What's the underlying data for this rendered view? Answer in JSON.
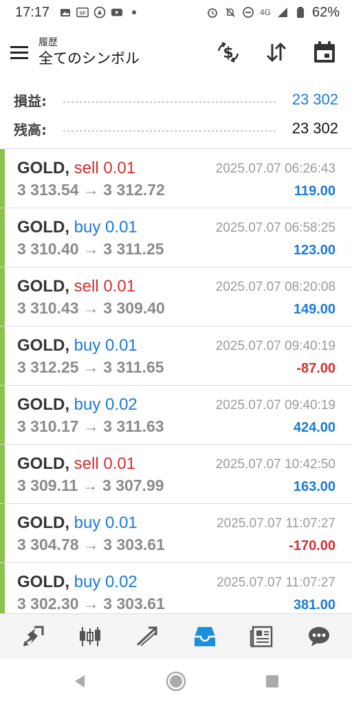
{
  "status_bar": {
    "time": "17:17",
    "network": "4G",
    "battery": "62%",
    "left_icons": [
      "photo-icon",
      "sf-icon",
      "notification-icon",
      "youtube-icon",
      "dot-icon"
    ],
    "right_icons": [
      "alarm-icon",
      "mute-icon",
      "dnd-icon",
      "signal-icon",
      "battery-icon"
    ]
  },
  "app_bar": {
    "subtitle": "履歴",
    "title": "全てのシンボル",
    "actions": [
      "deposit-icon",
      "sort-icon",
      "calendar-icon"
    ]
  },
  "summary": {
    "profit_label": "損益:",
    "profit_value": "23 302",
    "balance_label": "残高:",
    "balance_value": "23 302"
  },
  "trades": [
    {
      "symbol": "GOLD,",
      "side": "sell",
      "volume": "0.01",
      "prices": "3 313.54 → 3 312.72",
      "time": "2025.07.07 06:26:43",
      "profit": "119.00"
    },
    {
      "symbol": "GOLD,",
      "side": "buy",
      "volume": "0.01",
      "prices": "3 310.40 → 3 311.25",
      "time": "2025.07.07 06:58:25",
      "profit": "123.00"
    },
    {
      "symbol": "GOLD,",
      "side": "sell",
      "volume": "0.01",
      "prices": "3 310.43 → 3 309.40",
      "time": "2025.07.07 08:20:08",
      "profit": "149.00"
    },
    {
      "symbol": "GOLD,",
      "side": "buy",
      "volume": "0.01",
      "prices": "3 312.25 → 3 311.65",
      "time": "2025.07.07 09:40:19",
      "profit": "-87.00"
    },
    {
      "symbol": "GOLD,",
      "side": "buy",
      "volume": "0.02",
      "prices": "3 310.17 → 3 311.63",
      "time": "2025.07.07 09:40:19",
      "profit": "424.00"
    },
    {
      "symbol": "GOLD,",
      "side": "sell",
      "volume": "0.01",
      "prices": "3 309.11 → 3 307.99",
      "time": "2025.07.07 10:42:50",
      "profit": "163.00"
    },
    {
      "symbol": "GOLD,",
      "side": "buy",
      "volume": "0.01",
      "prices": "3 304.78 → 3 303.61",
      "time": "2025.07.07 11:07:27",
      "profit": "-170.00"
    },
    {
      "symbol": "GOLD,",
      "side": "buy",
      "volume": "0.02",
      "prices": "3 302.30 → 3 303.61",
      "time": "2025.07.07 11:07:27",
      "profit": "381.00"
    }
  ],
  "bottom_nav": {
    "items": [
      "quotes-icon",
      "chart-icon",
      "trade-icon",
      "history-icon",
      "news-icon",
      "chat-icon"
    ],
    "active": "history-icon",
    "active_color": "#1a8fdc"
  },
  "colors": {
    "positive": "#1a7ad6",
    "negative": "#d32f2f",
    "trade_bar": "#8bc34a"
  }
}
